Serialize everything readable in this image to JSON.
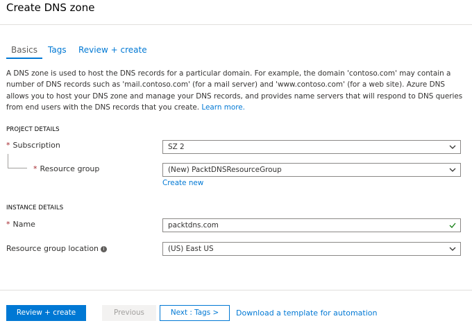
{
  "page": {
    "title": "Create DNS zone"
  },
  "tabs": [
    {
      "label": "Basics"
    },
    {
      "label": "Tags"
    },
    {
      "label": "Review + create"
    }
  ],
  "description": {
    "text": "A DNS zone is used to host the DNS records for a particular domain. For example, the domain 'contoso.com' may contain a number of DNS records such as 'mail.contoso.com' (for a mail server) and 'www.contoso.com' (for a web site). Azure DNS allows you to host your DNS zone and manage your DNS records, and provides name servers that will respond to DNS queries from end users with the DNS records that you create.",
    "learn_more": "Learn more."
  },
  "project_details": {
    "heading": "PROJECT DETAILS",
    "subscription": {
      "label": "Subscription",
      "value": "SZ 2"
    },
    "resource_group": {
      "label": "Resource group",
      "value": "(New) PacktDNSResourceGroup",
      "create_new": "Create new"
    }
  },
  "instance_details": {
    "heading": "INSTANCE DETAILS",
    "name": {
      "label": "Name",
      "value": "packtdns.com"
    },
    "location": {
      "label": "Resource group location",
      "value": "(US) East US"
    }
  },
  "required_marker": "*",
  "footer": {
    "review_create": "Review + create",
    "previous": "Previous",
    "next": "Next : Tags >",
    "download": "Download a template for automation"
  },
  "icons": {
    "chevron": "chevron-down-icon",
    "check": "checkmark-icon",
    "info": "info-icon"
  },
  "colors": {
    "accent": "#0078d4",
    "required": "#a4262c",
    "valid": "#107c10"
  }
}
